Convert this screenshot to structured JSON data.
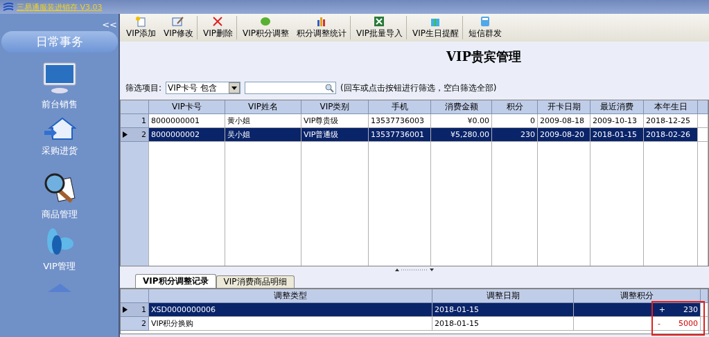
{
  "window": {
    "title": "三易通服装进销存 V3.03"
  },
  "sidebar": {
    "collapse": "<<",
    "section": "日常事务",
    "items": [
      {
        "label": "前台销售",
        "kind": "monitor"
      },
      {
        "label": "采购进货",
        "kind": "house"
      },
      {
        "label": "商品管理",
        "kind": "magnifier"
      },
      {
        "label": "VIP管理",
        "kind": "petals"
      },
      {
        "kind": "partial"
      }
    ]
  },
  "toolbar": [
    {
      "label": "VIP添加",
      "kind": "add",
      "sep": false
    },
    {
      "label": "VIP修改",
      "kind": "edit",
      "sep": true
    },
    {
      "label": "VIP删除",
      "kind": "delete",
      "sep": true
    },
    {
      "label": "VIP积分调整",
      "kind": "leaf",
      "sep": false
    },
    {
      "label": "积分调整统计",
      "kind": "chart",
      "sep": true
    },
    {
      "label": "VIP批量导入",
      "kind": "excel",
      "sep": true
    },
    {
      "label": "VIP生日提醒",
      "kind": "gift",
      "sep": true
    },
    {
      "label": "短信群发",
      "kind": "phone",
      "sep": false
    }
  ],
  "page_title": "VIP贵宾管理",
  "filter": {
    "label": "筛选项目:",
    "select": "VIP卡号 包含",
    "hint": "(回车或点击按钮进行筛选，空白筛选全部)"
  },
  "table": {
    "columns": [
      "VIP卡号",
      "VIP姓名",
      "VIP类别",
      "手机",
      "消费金额",
      "积分",
      "开卡日期",
      "最近消费",
      "本年生日"
    ],
    "rows": [
      {
        "num": "1",
        "selected": false,
        "cells": [
          "8000000001",
          "黄小姐",
          "VIP尊贵级",
          "13537736003",
          "¥0.00",
          "0",
          "2009-08-18",
          "2009-10-13",
          "2018-12-25"
        ]
      },
      {
        "num": "2",
        "selected": true,
        "cells": [
          "8000000002",
          "吴小姐",
          "VIP普通级",
          "13537736001",
          "¥5,280.00",
          "230",
          "2009-08-20",
          "2018-01-15",
          "2018-02-26"
        ]
      }
    ]
  },
  "tabs": [
    {
      "label": "VIP积分调整记录",
      "selected": true
    },
    {
      "label": "VIP消费商品明细",
      "selected": false
    }
  ],
  "detail": {
    "columns": [
      "调整类型",
      "调整日期",
      "调整积分"
    ],
    "rows": [
      {
        "num": "1",
        "selected": true,
        "kind": "plus",
        "type": "XSD0000000006",
        "date": "2018-01-15",
        "sign": "+",
        "points": "230"
      },
      {
        "num": "2",
        "selected": false,
        "kind": "minus",
        "type": "VIP积分换购",
        "date": "2018-01-15",
        "sign": "-",
        "points": "5000"
      }
    ]
  }
}
